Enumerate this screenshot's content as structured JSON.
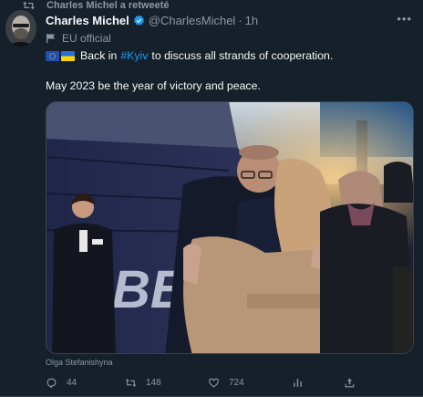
{
  "retweet": {
    "text": "Charles Michel a retweeté"
  },
  "author": {
    "display_name": "Charles Michel",
    "handle": "@CharlesMichel",
    "separator": "·",
    "time": "1h",
    "label": "EU official",
    "verified": true
  },
  "tweet": {
    "line1_before": "Back in",
    "hashtag": "#Kyiv",
    "line1_after": "to discuss all strands of cooperation.",
    "line2": "May 2023 be the year of victory and peace.",
    "emoji": [
      "EU flag",
      "Ukraine flag"
    ]
  },
  "media": {
    "caption": "Olga Stefanishyna"
  },
  "actions": {
    "replies": "44",
    "retweets": "148",
    "likes": "724"
  },
  "colors": {
    "background": "#15202b",
    "text": "#f7f9f9",
    "muted": "#8b98a5",
    "link": "#1d9bf0",
    "verified": "#1d9bf0"
  },
  "icons": [
    "retweet-icon",
    "verified-icon",
    "more-icon",
    "flag-icon",
    "reply-icon",
    "like-icon",
    "stats-icon",
    "share-icon"
  ]
}
